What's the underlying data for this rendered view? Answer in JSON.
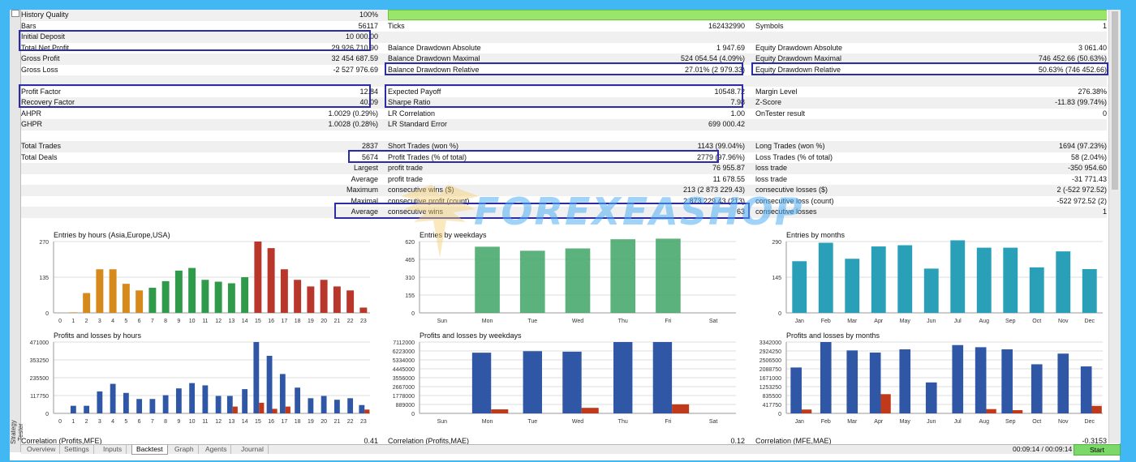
{
  "report_rows": [
    {
      "alt": true,
      "l1": "History Quality",
      "v1": "100%",
      "l2": "",
      "v2": "",
      "l3": "",
      "v3": "",
      "history_bar": true
    },
    {
      "alt": false,
      "l1": "Bars",
      "v1": "56117",
      "l2": "Ticks",
      "v2": "162432990",
      "l3": "Symbols",
      "v3": "1"
    },
    {
      "alt": true,
      "l1": "Initial Deposit",
      "v1": "10 000.00",
      "l2": "",
      "v2": "",
      "l3": "",
      "v3": ""
    },
    {
      "alt": false,
      "l1": "Total Net Profit",
      "v1": "29 926 710.90",
      "l2": "Balance Drawdown Absolute",
      "v2": "1 947.69",
      "l3": "Equity Drawdown Absolute",
      "v3": "3 061.40"
    },
    {
      "alt": true,
      "l1": "Gross Profit",
      "v1": "32 454 687.59",
      "l2": "Balance Drawdown Maximal",
      "v2": "524 054.54 (4.09%)",
      "l3": "Equity Drawdown Maximal",
      "v3": "746 452.66 (50.63%)"
    },
    {
      "alt": false,
      "l1": "Gross Loss",
      "v1": "-2 527 976.69",
      "l2": "Balance Drawdown Relative",
      "v2": "27.01% (2 979.33)",
      "l3": "Equity Drawdown Relative",
      "v3": "50.63% (746 452.66)"
    },
    {
      "alt": true,
      "l1": "",
      "v1": "",
      "l2": "",
      "v2": "",
      "l3": "",
      "v3": ""
    },
    {
      "alt": false,
      "l1": "Profit Factor",
      "v1": "12.84",
      "l2": "Expected Payoff",
      "v2": "10548.72",
      "l3": "Margin Level",
      "v3": "276.38%"
    },
    {
      "alt": true,
      "l1": "Recovery Factor",
      "v1": "40.09",
      "l2": "Sharpe Ratio",
      "v2": "7.98",
      "l3": "Z-Score",
      "v3": "-11.83 (99.74%)"
    },
    {
      "alt": false,
      "l1": "AHPR",
      "v1": "1.0029 (0.29%)",
      "l2": "LR Correlation",
      "v2": "1.00",
      "l3": "OnTester result",
      "v3": "0"
    },
    {
      "alt": true,
      "l1": "GHPR",
      "v1": "1.0028 (0.28%)",
      "l2": "LR Standard Error",
      "v2": "699 000.42",
      "l3": "",
      "v3": ""
    },
    {
      "alt": false,
      "l1": "",
      "v1": "",
      "l2": "",
      "v2": "",
      "l3": "",
      "v3": ""
    },
    {
      "alt": true,
      "l1": "Total Trades",
      "v1": "2837",
      "l2": "Short Trades (won %)",
      "v2": "1143 (99.04%)",
      "l3": "Long Trades (won %)",
      "v3": "1694 (97.23%)"
    },
    {
      "alt": false,
      "l1": "Total Deals",
      "v1": "5674",
      "l2": "Profit Trades (% of total)",
      "v2": "2779 (97.96%)",
      "l3": "Loss Trades (% of total)",
      "v3": "58 (2.04%)"
    },
    {
      "alt": true,
      "l1": "",
      "v1": "Largest",
      "l2": "profit trade",
      "v2": "76 955.87",
      "l3": "loss trade",
      "v3": "-350 954.60"
    },
    {
      "alt": false,
      "l1": "",
      "v1": "Average",
      "l2": "profit trade",
      "v2": "11 678.55",
      "l3": "loss trade",
      "v3": "-31 771.43"
    },
    {
      "alt": true,
      "l1": "",
      "v1": "Maximum",
      "l2": "consecutive wins ($)",
      "v2": "213 (2 873 229.43)",
      "l3": "consecutive losses ($)",
      "v3": "2 (-522 972.52)"
    },
    {
      "alt": false,
      "l1": "",
      "v1": "Maximal",
      "l2": "consecutive profit (count)",
      "v2": "2 873 229.43 (213)",
      "l3": "consecutive loss (count)",
      "v3": "-522 972.52 (2)"
    },
    {
      "alt": true,
      "l1": "",
      "v1": "Average",
      "l2": "consecutive wins",
      "v2": "63",
      "l3": "consecutive losses",
      "v3": "1"
    }
  ],
  "watermark": "FOREXEASHOP",
  "colors": {
    "green_bar": "#2e9a4a",
    "orange_bar": "#d68a1c",
    "red_bar": "#b8372a",
    "blue_bar": "#2f57a6",
    "teal_bar": "#2aa0b8",
    "loss_bar": "#c0391b",
    "highlight_box": "#2c2ca8"
  },
  "correlations": [
    {
      "label": "Correlation (Profits,MFE)",
      "value": "0.41"
    },
    {
      "label": "Correlation (Profits,MAE)",
      "value": "0.12"
    },
    {
      "label": "Correlation (MFE,MAE)",
      "value": "-0.3153"
    }
  ],
  "tabs": [
    "Overview",
    "Settings",
    "Inputs",
    "Backtest",
    "Graph",
    "Agents",
    "Journal"
  ],
  "active_tab": "Backtest",
  "timer": "00:09:14 / 00:09:14",
  "start_label": "Start",
  "side_label": "Strategy Tester",
  "chart_data": [
    {
      "id": "entries-hours",
      "type": "bar",
      "title": "Entries by hours (Asia,Europe,USA)",
      "categories": [
        "0",
        "1",
        "2",
        "3",
        "4",
        "5",
        "6",
        "7",
        "8",
        "9",
        "10",
        "11",
        "12",
        "13",
        "14",
        "15",
        "16",
        "17",
        "18",
        "19",
        "20",
        "21",
        "22",
        "23"
      ],
      "values": [
        0,
        2,
        75,
        165,
        165,
        110,
        85,
        95,
        120,
        160,
        170,
        125,
        118,
        112,
        135,
        270,
        245,
        165,
        125,
        100,
        125,
        100,
        85,
        20
      ],
      "yticks": [
        "0",
        "135",
        "270"
      ],
      "ylim": [
        0,
        270
      ],
      "bar_colors": [
        "orange",
        "orange",
        "orange",
        "orange",
        "orange",
        "orange",
        "orange",
        "green",
        "green",
        "green",
        "green",
        "green",
        "green",
        "green",
        "green",
        "red",
        "red",
        "red",
        "red",
        "red",
        "red",
        "red",
        "red",
        "red"
      ]
    },
    {
      "id": "entries-weekdays",
      "type": "bar",
      "title": "Entries by weekdays",
      "categories": [
        "Sun",
        "Mon",
        "Tue",
        "Wed",
        "Thu",
        "Fri",
        "Sat"
      ],
      "values": [
        0,
        575,
        540,
        560,
        640,
        645,
        0
      ],
      "yticks": [
        "0",
        "155",
        "310",
        "465",
        "620"
      ],
      "ylim": [
        0,
        620
      ]
    },
    {
      "id": "entries-months",
      "type": "bar",
      "title": "Entries by months",
      "categories": [
        "Jan",
        "Feb",
        "Mar",
        "Apr",
        "May",
        "Jun",
        "Jul",
        "Aug",
        "Sep",
        "Oct",
        "Nov",
        "Dec"
      ],
      "values": [
        210,
        285,
        220,
        270,
        275,
        180,
        295,
        265,
        265,
        185,
        250,
        178
      ],
      "yticks": [
        "0",
        "145",
        "290"
      ],
      "ylim": [
        0,
        290
      ]
    },
    {
      "id": "pl-hours",
      "type": "bar",
      "title": "Profits and losses by hours",
      "categories": [
        "0",
        "1",
        "2",
        "3",
        "4",
        "5",
        "6",
        "7",
        "8",
        "9",
        "10",
        "11",
        "12",
        "13",
        "14",
        "15",
        "16",
        "17",
        "18",
        "19",
        "20",
        "21",
        "22",
        "23"
      ],
      "series": [
        {
          "values": [
            0,
            50000,
            50000,
            145000,
            195000,
            135000,
            95000,
            95000,
            120000,
            165000,
            200000,
            185000,
            115000,
            115000,
            160000,
            471000,
            380000,
            260000,
            170000,
            100000,
            115000,
            90000,
            100000,
            55000
          ]
        },
        {
          "values": [
            0,
            0,
            0,
            0,
            0,
            0,
            0,
            0,
            0,
            0,
            0,
            0,
            0,
            45000,
            0,
            70000,
            30000,
            45000,
            0,
            0,
            0,
            0,
            0,
            25000
          ]
        }
      ],
      "yticks": [
        "0",
        "117750",
        "235500",
        "353250",
        "471000"
      ],
      "ylim": [
        0,
        471000
      ]
    },
    {
      "id": "pl-weekdays",
      "type": "bar",
      "title": "Profits and losses by weekdays",
      "categories": [
        "Sun",
        "Mon",
        "Tue",
        "Wed",
        "Thu",
        "Fri",
        "Sat"
      ],
      "series": [
        {
          "values": [
            0,
            6050000,
            6200000,
            6150000,
            7112000,
            7112000,
            0
          ]
        },
        {
          "values": [
            0,
            400000,
            0,
            550000,
            0,
            900000,
            0
          ]
        }
      ],
      "yticks": [
        "0",
        "889000",
        "1778000",
        "2667000",
        "3556000",
        "4445000",
        "5334000",
        "6223000",
        "7112000"
      ],
      "ylim": [
        0,
        7112000
      ]
    },
    {
      "id": "pl-months",
      "type": "bar",
      "title": "Profits and losses by months",
      "categories": [
        "Jan",
        "Feb",
        "Mar",
        "Apr",
        "May",
        "Jun",
        "Jul",
        "Aug",
        "Sep",
        "Oct",
        "Nov",
        "Dec"
      ],
      "series": [
        {
          "values": [
            2150000,
            3342000,
            2950000,
            2850000,
            3000000,
            1450000,
            3200000,
            3100000,
            3000000,
            2300000,
            2800000,
            2200000
          ]
        },
        {
          "values": [
            180000,
            0,
            0,
            900000,
            0,
            0,
            0,
            200000,
            150000,
            0,
            0,
            350000
          ]
        }
      ],
      "yticks": [
        "0",
        "417750",
        "835500",
        "1253250",
        "1671000",
        "2088750",
        "2506500",
        "2924250",
        "3342000"
      ],
      "ylim": [
        0,
        3342000
      ]
    }
  ]
}
